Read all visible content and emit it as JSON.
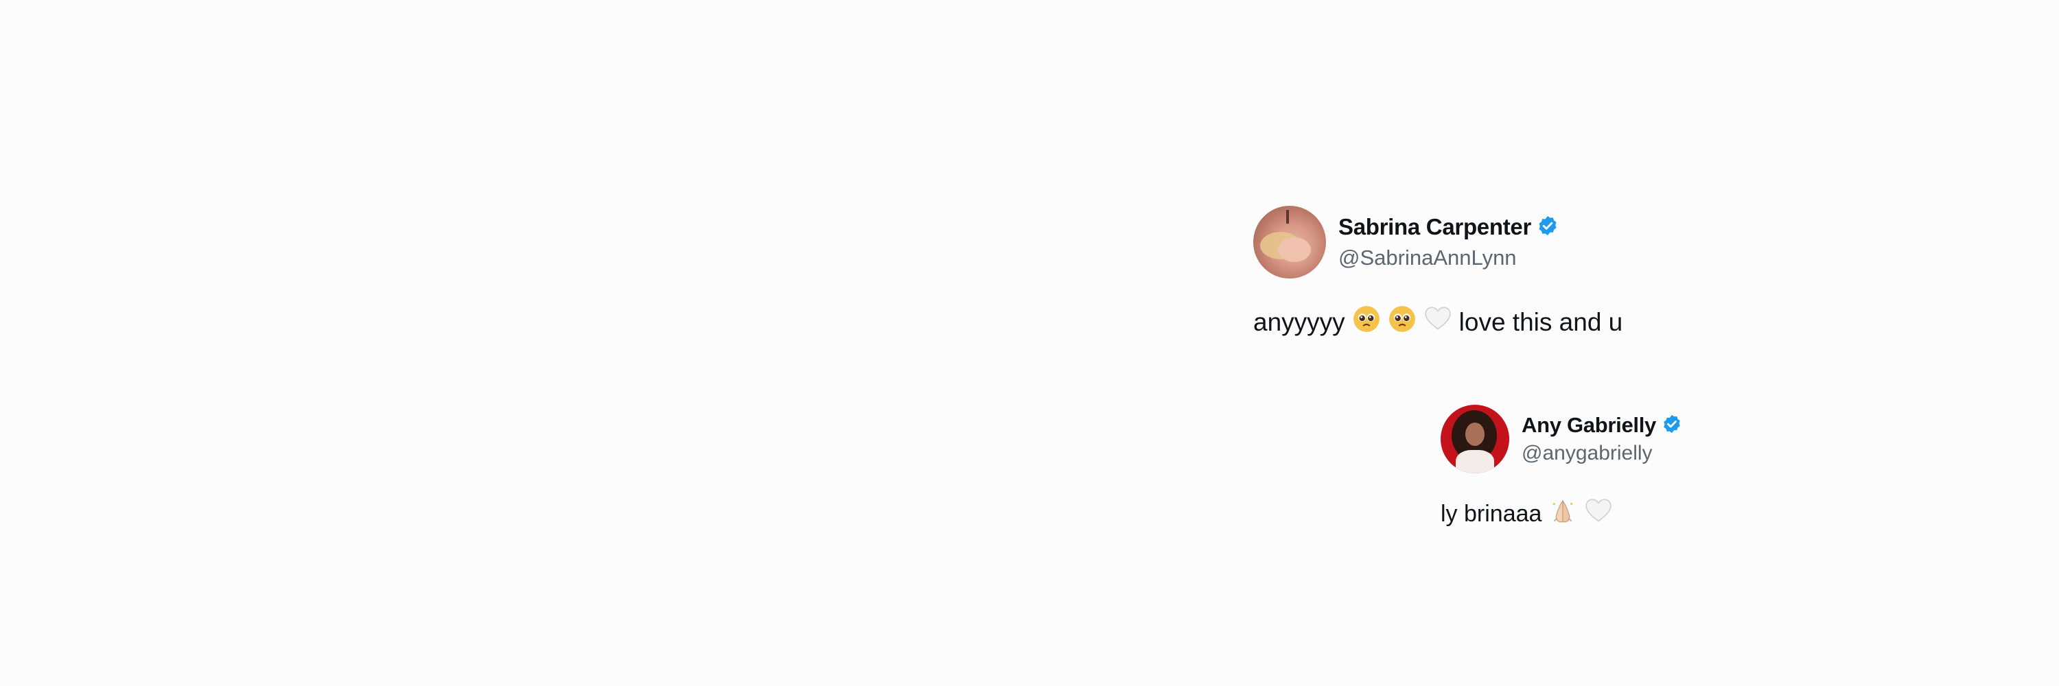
{
  "tweets": [
    {
      "display_name": "Sabrina Carpenter",
      "handle": "@SabrinaAnnLynn",
      "verified": true,
      "text_before": "anyyyyy",
      "emojis": [
        "pleading-face-emoji",
        "pleading-face-emoji",
        "white-heart-emoji"
      ],
      "text_after": "love this and u"
    },
    {
      "display_name": "Any Gabrielly",
      "handle": "@anygabrielly",
      "verified": true,
      "text_before": "ly brinaaa",
      "emojis": [
        "folded-hands-light-skin-emoji",
        "white-heart-emoji"
      ],
      "text_after": ""
    }
  ],
  "colors": {
    "background": "#fdfcfd",
    "text": "#0f1419",
    "handle": "#5b6670",
    "verified_blue": "#1d9bf0"
  }
}
